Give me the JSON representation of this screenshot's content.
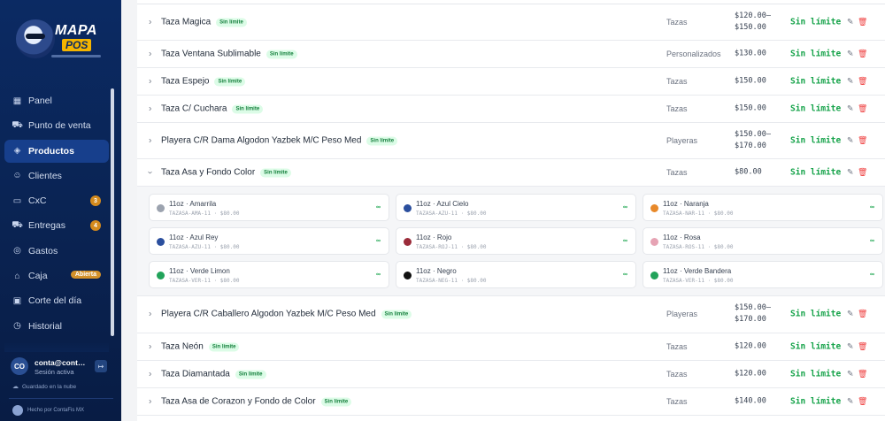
{
  "sidebar": {
    "logo": {
      "line1": "MAPA",
      "line2": "POS"
    },
    "items": [
      {
        "label": "Panel",
        "icon": "grid-icon"
      },
      {
        "label": "Punto de venta",
        "icon": "cart-icon"
      },
      {
        "label": "Productos",
        "icon": "box-icon",
        "active": true
      },
      {
        "label": "Clientes",
        "icon": "users-icon"
      },
      {
        "label": "CxC",
        "icon": "card-icon",
        "badge": "3"
      },
      {
        "label": "Entregas",
        "icon": "truck-icon",
        "badge": "4"
      },
      {
        "label": "Gastos",
        "icon": "money-icon"
      },
      {
        "label": "Caja",
        "icon": "register-icon",
        "badge": "Abierta"
      },
      {
        "label": "Corte del día",
        "icon": "calendar-icon"
      },
      {
        "label": "Historial",
        "icon": "history-icon"
      }
    ],
    "user": {
      "initials": "CO",
      "email": "conta@contafi...",
      "status": "Sesión activa"
    },
    "cloud": "Guardado en la nube",
    "footer": "Hecho por ContaFis MX"
  },
  "products": [
    {
      "name": "Taza Magica",
      "badge": "Sin límite",
      "category": "Tazas",
      "price": "$120.00–\n$150.00",
      "stock": "Sin límite"
    },
    {
      "name": "Taza Ventana Sublimable",
      "badge": "Sin límite",
      "category": "Personalizados",
      "price": "$130.00",
      "stock": "Sin límite"
    },
    {
      "name": "Taza Espejo",
      "badge": "Sin límite",
      "category": "Tazas",
      "price": "$150.00",
      "stock": "Sin límite"
    },
    {
      "name": "Taza C/ Cuchara",
      "badge": "Sin límite",
      "category": "Tazas",
      "price": "$150.00",
      "stock": "Sin límite"
    },
    {
      "name": "Playera C/R Dama Algodon Yazbek M/C Peso Med",
      "badge": "Sin límite",
      "category": "Playeras",
      "price": "$150.00–\n$170.00",
      "stock": "Sin límite"
    },
    {
      "name": "Taza Asa y Fondo Color",
      "badge": "Sin límite",
      "category": "Tazas",
      "price": "$80.00",
      "stock": "Sin límite",
      "expanded": true
    },
    {
      "name": "Playera C/R Caballero Algodon Yazbek M/C Peso Med",
      "badge": "Sin límite",
      "category": "Playeras",
      "price": "$150.00–\n$170.00",
      "stock": "Sin límite"
    },
    {
      "name": "Taza Neón",
      "badge": "Sin límite",
      "category": "Tazas",
      "price": "$120.00",
      "stock": "Sin límite"
    },
    {
      "name": "Taza Diamantada",
      "badge": "Sin límite",
      "category": "Tazas",
      "price": "$120.00",
      "stock": "Sin límite"
    },
    {
      "name": "Taza Asa de Corazon y Fondo de Color",
      "badge": "Sin límite",
      "category": "Tazas",
      "price": "$140.00",
      "stock": "Sin límite"
    }
  ],
  "variants": [
    {
      "name": "11oz · Amarrila",
      "sku": "TAZASA-AMA-11 · $80.00",
      "color": "#9ca3af",
      "stock": "∞"
    },
    {
      "name": "11oz · Azul Cielo",
      "sku": "TAZASA-AZU-11 · $80.00",
      "color": "#2b4f9e",
      "stock": "∞"
    },
    {
      "name": "11oz · Naranja",
      "sku": "TAZASA-NAR-11 · $80.00",
      "color": "#e8892a",
      "stock": "∞"
    },
    {
      "name": "11oz · Azul Rey",
      "sku": "TAZASA-AZU-11 · $80.00",
      "color": "#2b4f9e",
      "stock": "∞"
    },
    {
      "name": "11oz · Rojo",
      "sku": "TAZASA-ROJ-11 · $80.00",
      "color": "#9b2c3a",
      "stock": "∞"
    },
    {
      "name": "11oz · Rosa",
      "sku": "TAZASA-ROS-11 · $80.00",
      "color": "#e6a3b4",
      "stock": "∞"
    },
    {
      "name": "11oz · Verde Limon",
      "sku": "TAZASA-VER-11 · $80.00",
      "color": "#22a35a",
      "stock": "∞"
    },
    {
      "name": "11oz · Negro",
      "sku": "TAZASA-NEG-11 · $80.00",
      "color": "#111111",
      "stock": "∞"
    },
    {
      "name": "11oz · Verde Bandera",
      "sku": "TAZASA-VER-11 · $80.00",
      "color": "#22a35a",
      "stock": "∞"
    }
  ]
}
